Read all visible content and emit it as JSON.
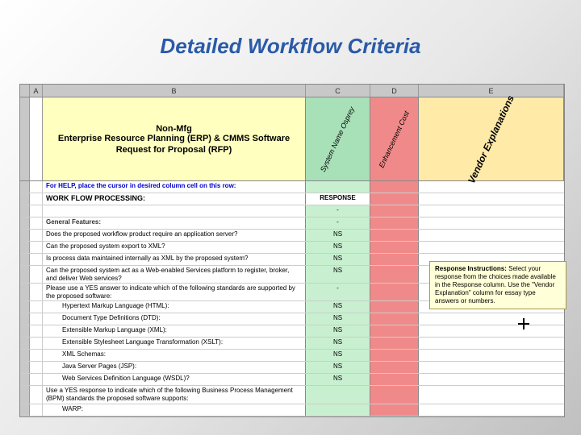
{
  "page_title": "Detailed Workflow Criteria",
  "columns": {
    "a": "A",
    "b": "B",
    "c": "C",
    "d": "D",
    "e": "E"
  },
  "header": {
    "line1": "Non-Mfg",
    "line2": "Enterprise Resource Planning (ERP)   &   CMMS Software",
    "line3": "Request for Proposal (RFP)",
    "col_c": "System Name Osprey",
    "col_d": "Enhancement Cost",
    "col_e": "Vendor Explanations"
  },
  "rows": [
    {
      "type": "help",
      "b": "For HELP, place the cursor in desired column cell on this row:",
      "c": ""
    },
    {
      "type": "section",
      "b": "WORK FLOW PROCESSING:",
      "c": "RESPONSE"
    },
    {
      "type": "blank",
      "b": "",
      "c": "-"
    },
    {
      "type": "subhead",
      "b": "General Features:",
      "c": "-"
    },
    {
      "type": "item",
      "b": "Does the proposed workflow product require an application server?",
      "c": "NS"
    },
    {
      "type": "item",
      "b": "Can the proposed system export to XML?",
      "c": "NS"
    },
    {
      "type": "item",
      "b": "Is process data maintained internally as XML by the proposed system?",
      "c": "NS",
      "multiline": true
    },
    {
      "type": "item",
      "b": "Can the proposed system act as a Web-enabled Services platform to register, broker, and deliver Web services?",
      "c": "NS",
      "multiline": true
    },
    {
      "type": "item",
      "b": "Please use a YES answer to indicate which of the following standards are supported by the proposed software:",
      "c": "-",
      "multiline": true
    },
    {
      "type": "sub",
      "b": "Hypertext Markup Language (HTML):",
      "c": "NS"
    },
    {
      "type": "sub",
      "b": "Document Type Definitions (DTD):",
      "c": "NS"
    },
    {
      "type": "sub",
      "b": "Extensible Markup Language (XML):",
      "c": "NS"
    },
    {
      "type": "sub",
      "b": "Extensible Stylesheet Language Transformation (XSLT):",
      "c": "NS"
    },
    {
      "type": "sub",
      "b": "XML Schemas:",
      "c": "NS"
    },
    {
      "type": "sub",
      "b": "Java Server Pages (JSP):",
      "c": "NS"
    },
    {
      "type": "sub",
      "b": "Web Services Definition Language (WSDL)?",
      "c": "NS"
    },
    {
      "type": "item",
      "b": "Use a YES response to indicate which of the following Business Process Management (BPM) standards the proposed software supports:",
      "c": "",
      "multiline": true
    },
    {
      "type": "sub",
      "b": "WARP:",
      "c": ""
    }
  ],
  "tooltip": {
    "title": "Response Instructions:",
    "body": "Select your response from the choices made available in the Response column. Use the \"Vendor Explanation\" column for essay type answers or numbers."
  }
}
